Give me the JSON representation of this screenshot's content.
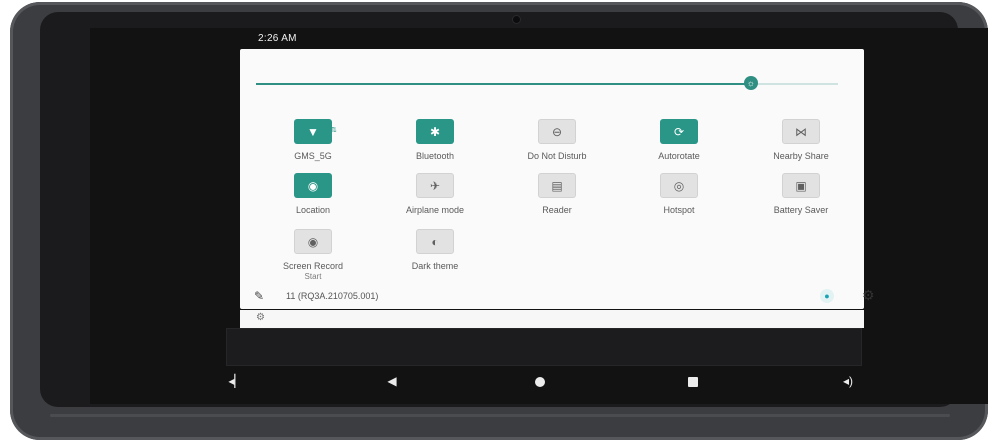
{
  "status_bar": {
    "time": "2:26 AM"
  },
  "brightness": {
    "level_percent": 85
  },
  "tiles": [
    {
      "id": "wifi",
      "label": "GMS_5G",
      "state": "on",
      "icon": "wifi-icon",
      "glyph": "▼"
    },
    {
      "id": "bluetooth",
      "label": "Bluetooth",
      "state": "on",
      "icon": "bluetooth-icon",
      "glyph": "✱"
    },
    {
      "id": "dnd",
      "label": "Do Not Disturb",
      "state": "off",
      "icon": "do-not-disturb-icon",
      "glyph": "⊖"
    },
    {
      "id": "autorotate",
      "label": "Autorotate",
      "state": "on",
      "icon": "autorotate-icon",
      "glyph": "⟳"
    },
    {
      "id": "nearby",
      "label": "Nearby Share",
      "state": "off",
      "icon": "nearby-share-icon",
      "glyph": "⋈"
    },
    {
      "id": "location",
      "label": "Location",
      "state": "on",
      "icon": "location-icon",
      "glyph": "◉"
    },
    {
      "id": "airplane",
      "label": "Airplane mode",
      "state": "off",
      "icon": "airplane-icon",
      "glyph": "✈"
    },
    {
      "id": "reader",
      "label": "Reader",
      "state": "off",
      "icon": "reader-icon",
      "glyph": "▤"
    },
    {
      "id": "hotspot",
      "label": "Hotspot",
      "state": "off",
      "icon": "hotspot-icon",
      "glyph": "◎"
    },
    {
      "id": "battery",
      "label": "Battery Saver",
      "state": "off",
      "icon": "battery-saver-icon",
      "glyph": "▣"
    },
    {
      "id": "screenrecord",
      "label": "Screen Record",
      "sublabel": "Start",
      "state": "off",
      "icon": "screen-record-icon",
      "glyph": "◉"
    },
    {
      "id": "darktheme",
      "label": "Dark theme",
      "state": "off",
      "icon": "dark-theme-icon",
      "glyph": "◐"
    }
  ],
  "footer": {
    "build": "11 (RQ3A.210705.001)"
  },
  "colors": {
    "accent": "#2a9688",
    "tile_off": "#e2e2e2"
  }
}
